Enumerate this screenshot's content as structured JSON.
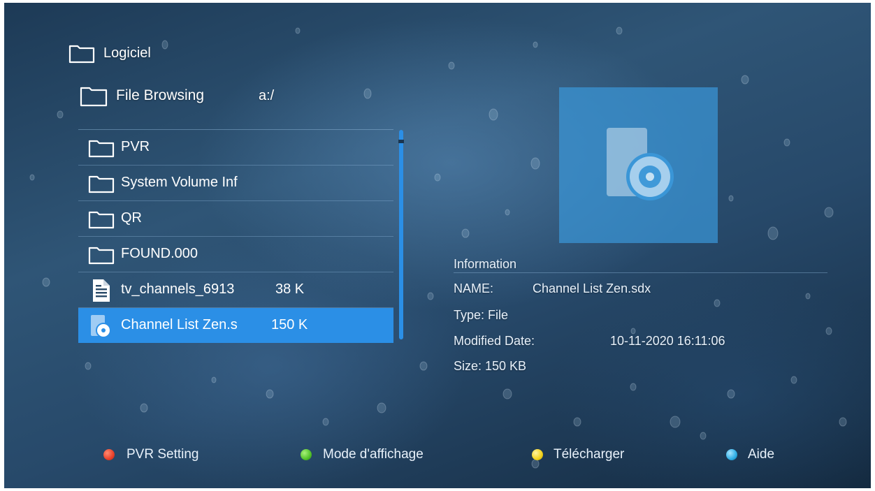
{
  "header": {
    "section_title": "Logiciel",
    "browse_label": "File Browsing",
    "path": "a:/"
  },
  "file_list": {
    "items": [
      {
        "name": "PVR",
        "size": "",
        "icon": "folder-icon"
      },
      {
        "name": "System Volume Inf",
        "size": "",
        "icon": "folder-icon"
      },
      {
        "name": "QR",
        "size": "",
        "icon": "folder-icon"
      },
      {
        "name": "FOUND.000",
        "size": "",
        "icon": "folder-icon"
      },
      {
        "name": "tv_channels_6913",
        "size": "38 K",
        "icon": "document-icon"
      },
      {
        "name": "Channel List Zen.s",
        "size": "150 K",
        "icon": "disc-file-icon",
        "selected": true
      }
    ],
    "scroll_position": 1.0
  },
  "info_panel": {
    "heading": "Information",
    "name_label": "NAME:",
    "name_value": "Channel List Zen.sdx",
    "type_text": "Type: File",
    "modified_label": "Modified Date:",
    "modified_value": "10-11-2020 16:11:06",
    "size_text": "Size: 150 KB",
    "preview_icon": "disc-file-icon"
  },
  "color_buttons": [
    {
      "color": "#e8402a",
      "label": "PVR Setting"
    },
    {
      "color": "#52c22a",
      "label": "Mode d'affichage"
    },
    {
      "color": "#f2d21b",
      "label": "Télécharger"
    },
    {
      "color": "#2eaee6",
      "label": "Aide"
    }
  ],
  "colors": {
    "selection": "#2b8fe6",
    "scrollbar": "#2b8fe6",
    "preview_tile": "#3a8fd0"
  }
}
